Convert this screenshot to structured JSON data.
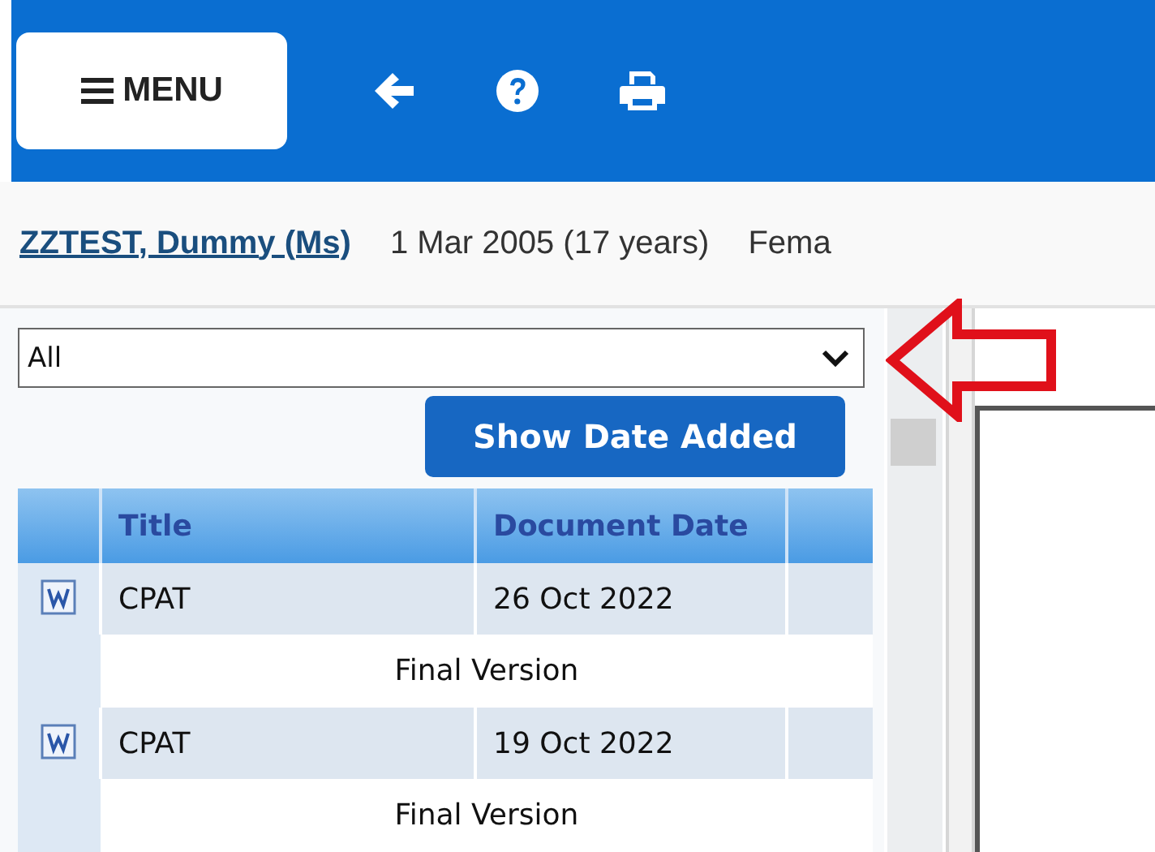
{
  "toolbar": {
    "menu_label": "MENU"
  },
  "patient": {
    "name": "ZZTEST, Dummy (Ms)",
    "birth": "1 Mar 2005 (17 years)",
    "gender": "Fema"
  },
  "filter": {
    "value": "All"
  },
  "show_date_button": "Show Date Added",
  "documents": {
    "columns": [
      "Title",
      "Document Date"
    ],
    "rows": [
      {
        "title": "CPAT",
        "date": "26 Oct 2022",
        "status": "Final Version"
      },
      {
        "title": "CPAT",
        "date": "19 Oct 2022",
        "status": "Final Version"
      }
    ]
  }
}
